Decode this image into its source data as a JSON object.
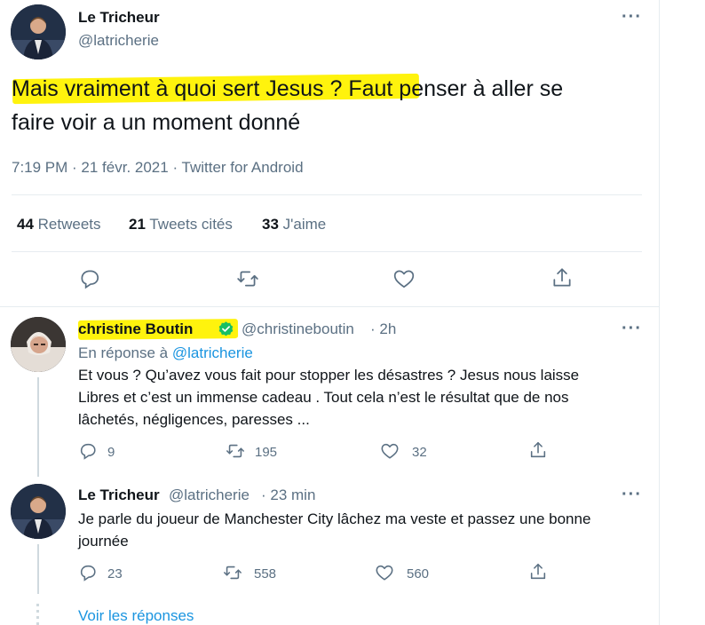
{
  "main_tweet": {
    "author_name": "Le Tricheur",
    "author_handle": "@latricherie",
    "text_line1": "Mais vraiment à quoi sert Jesus ? Faut penser à aller se",
    "text_line2": "faire voir a un moment donné",
    "meta": "7:19 PM · 21 févr. 2021 · Twitter for Android",
    "stats": {
      "retweets_count": "44",
      "retweets_label": "Retweets",
      "quotes_count": "21",
      "quotes_label": "Tweets cités",
      "likes_count": "33",
      "likes_label": "J'aime"
    }
  },
  "reply1": {
    "author_name": "christine Boutin",
    "author_handle": "@christineboutin",
    "time": "· 2h",
    "reply_prefix": "En réponse à",
    "reply_to": "@latricherie",
    "text_line1": "Et vous ? Qu’avez vous fait pour stopper les désastres ? Jesus nous laisse",
    "text_line2": "Libres et c’est un immense cadeau . Tout cela n’est le résultat que de nos",
    "text_line3": "lâchetés, négligences, paresses ...",
    "reply_count": "9",
    "retweet_count": "195",
    "like_count": "32"
  },
  "reply2": {
    "author_name": "Le Tricheur",
    "author_handle": "@latricherie",
    "time": "· 23 min",
    "text_line1": "Je parle du joueur de Manchester City lâchez ma veste et passez une bonne",
    "text_line2": "journée",
    "reply_count": "23",
    "retweet_count": "558",
    "like_count": "560"
  },
  "show_replies": "Voir les réponses",
  "icons": [
    "more-icon",
    "reply-icon",
    "retweet-icon",
    "like-icon",
    "share-icon",
    "verified-badge-icon"
  ],
  "colors": {
    "link": "#1b95e0",
    "highlight": "#fff200",
    "verified": "#17bf63",
    "muted": "#5b7083"
  }
}
